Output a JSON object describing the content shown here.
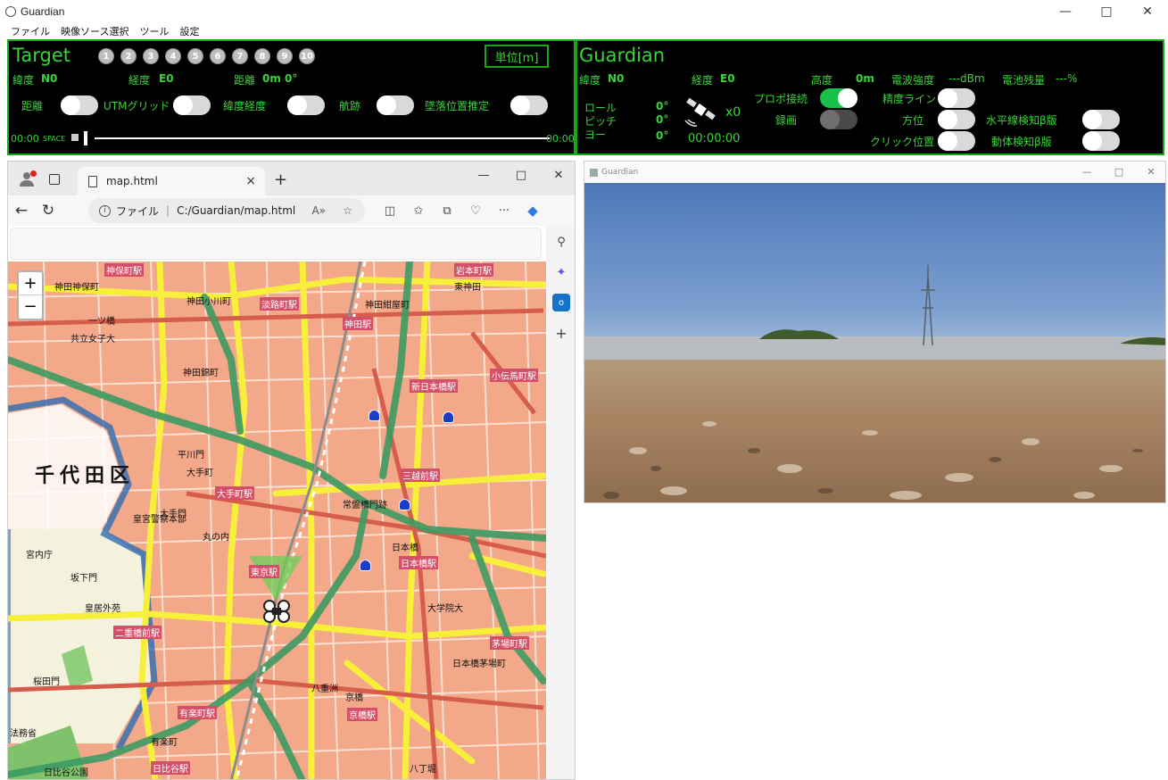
{
  "app": {
    "title": "Guardian",
    "menu": [
      "ファイル",
      "映像ソース選択",
      "ツール",
      "設定"
    ],
    "window_controls": {
      "minimize": "—",
      "maximize": "□",
      "close": "✕"
    }
  },
  "target": {
    "heading": "Target",
    "numbers": [
      "1",
      "2",
      "3",
      "4",
      "5",
      "6",
      "7",
      "8",
      "9",
      "10"
    ],
    "unit_button": "単位[m]",
    "lat_label": "緯度",
    "lat_value": "N0",
    "lon_label": "経度",
    "lon_value": "E0",
    "dist_label": "距離",
    "dist_value": "0m 0°",
    "toggles": [
      "距離",
      "UTMグリッド",
      "緯度経度",
      "航跡",
      "墜落位置推定"
    ],
    "time_start": "00:00",
    "space_label": "SPACE",
    "time_end": "00:00"
  },
  "guardian": {
    "heading": "Guardian",
    "lat_label": "緯度",
    "lat_value": "N0",
    "lon_label": "経度",
    "lon_value": "E0",
    "alt_label": "高度",
    "alt_value": "0m",
    "signal_label": "電波強度",
    "signal_value": "---dBm",
    "battery_label": "電池残量",
    "battery_value": "---%",
    "roll_label": "ロール",
    "roll_value": "0°",
    "pitch_label": "ピッチ",
    "pitch_value": "0°",
    "yaw_label": "ヨー",
    "yaw_value": "0°",
    "satellite_count": "x0",
    "elapsed": "00:00:00",
    "propo_label": "プロポ接続",
    "record_label": "録画",
    "precision_label": "精度ライン",
    "bearing_label": "方位",
    "click_label": "クリック位置",
    "horizon_label": "水平線検知β版",
    "motion_label": "動体検知β版"
  },
  "browser": {
    "tab_title": "map.html",
    "address_scheme": "ファイル",
    "address_path": "C:/Guardian/map.html",
    "new_tab": "+",
    "zoom_in": "+",
    "zoom_out": "−"
  },
  "map": {
    "area_label": "千代田区",
    "stations": [
      "東京駅",
      "大手町駅",
      "日本橋駅",
      "三越前駅",
      "神田駅",
      "二重橋前駅",
      "有楽町駅",
      "日比谷駅",
      "京橋駅",
      "茅場町駅",
      "新日本橋駅",
      "小伝馬町駅",
      "神保町駅",
      "岩本町駅",
      "淡路町駅"
    ],
    "places": [
      "神田神保町",
      "神田小川町",
      "神田錦町",
      "大手町",
      "丸の内",
      "皇居外苑",
      "桜田門",
      "坂下門",
      "宮内庁",
      "常盤橋門跡",
      "日本橋",
      "八重洲",
      "京橋",
      "八丁堀",
      "大学院大",
      "日本橋茅場町",
      "東神田",
      "神田紺屋町",
      "有楽町",
      "日比谷公園",
      "大手門",
      "皇宮警察本部",
      "平川門",
      "一ツ橋",
      "共立女子大",
      "法務省"
    ]
  },
  "video": {
    "title": "Guardian"
  },
  "colors": {
    "panel_bg": "#000000",
    "panel_border": "#1aa51a",
    "panel_text": "#36d536",
    "toggle_on": "#17c04a",
    "map_base": "#f2a889",
    "road_yellow": "#f7ef3a",
    "rail_green": "#3d9a63"
  }
}
